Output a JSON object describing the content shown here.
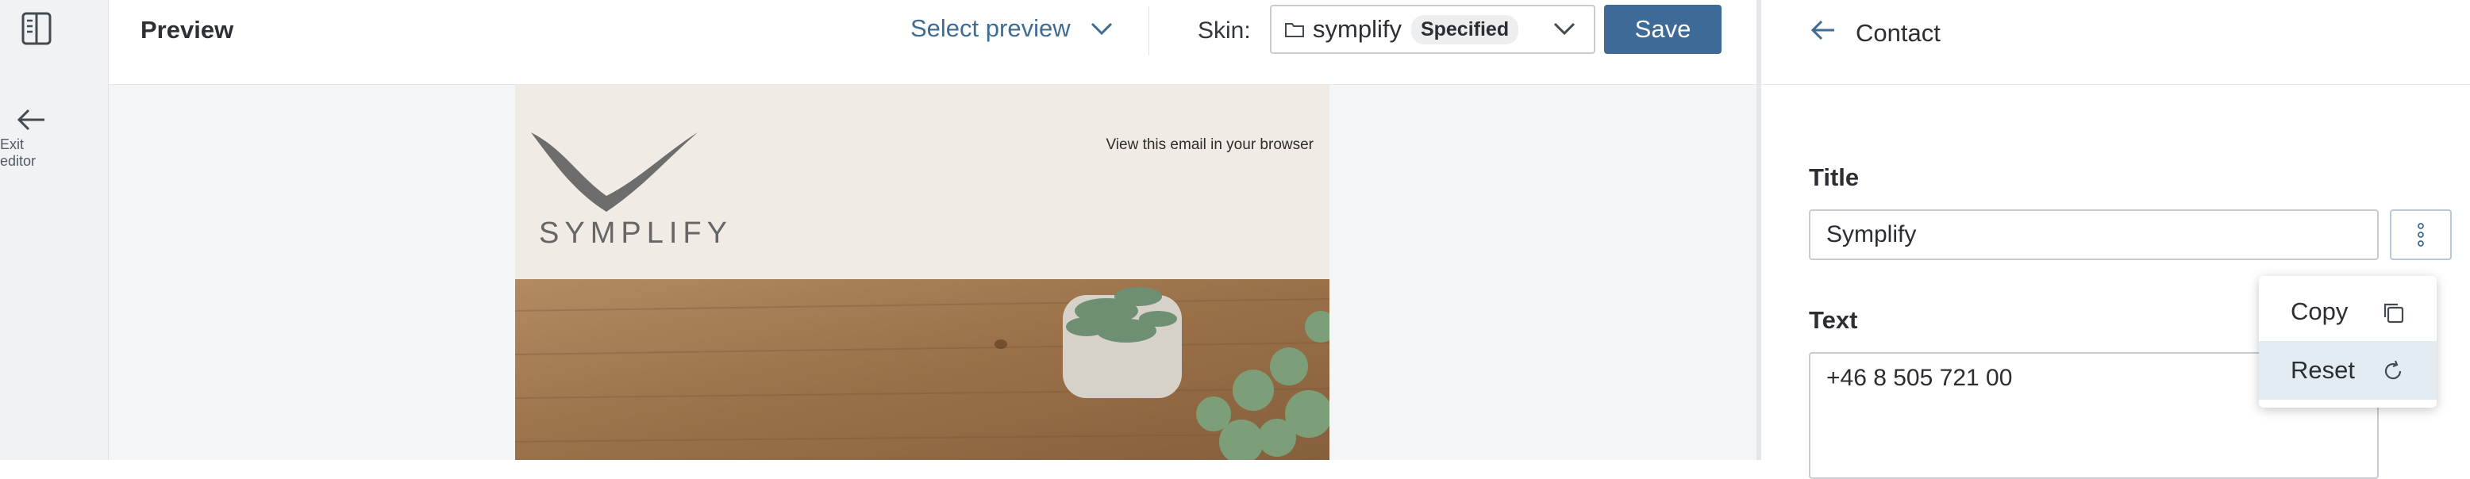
{
  "rail": {
    "exit_label": "Exit editor"
  },
  "topbar": {
    "title": "Preview",
    "select_preview": "Select preview",
    "skin_label": "Skin:",
    "skin_value": "symplify",
    "skin_badge": "Specified",
    "save_label": "Save"
  },
  "email": {
    "view_in_browser": "View this email in your browser",
    "brand": "SYMPLIFY"
  },
  "panel": {
    "title": "Contact",
    "title_field_label": "Title",
    "title_field_value": "Symplify",
    "text_field_label": "Text",
    "text_field_value": "+46 8 505 721 00",
    "menu": [
      {
        "label": "Copy",
        "icon": "copy-icon"
      },
      {
        "label": "Reset",
        "icon": "reset-icon"
      }
    ]
  },
  "colors": {
    "accent": "#3e6a97",
    "link": "#3f6c93",
    "header_bg": "#f0ebe4",
    "menu_active": "#e3ebf3"
  }
}
